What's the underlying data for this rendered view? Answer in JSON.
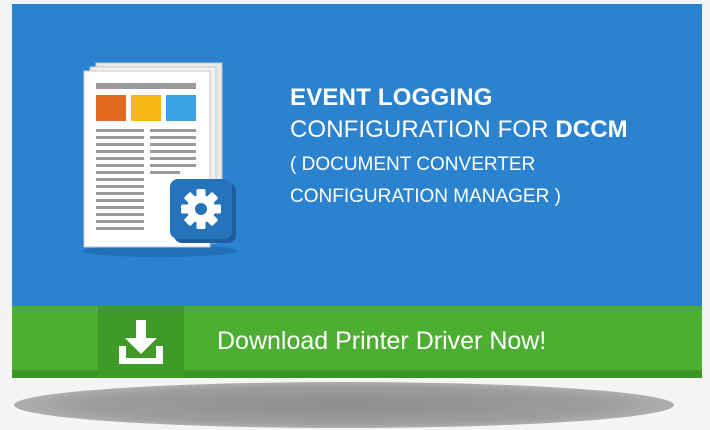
{
  "banner": {
    "title": "EVENT LOGGING",
    "subtitle_prefix": "CONFIGURATION FOR ",
    "subtitle_bold": "DCCM",
    "description_line1": "( DOCUMENT CONVERTER",
    "description_line2": "CONFIGURATION MANAGER )",
    "illustration_icon": "document-with-gear-icon"
  },
  "download": {
    "label": "Download Printer Driver Now!",
    "icon": "download-icon"
  },
  "colors": {
    "panel_blue": "#2b82cf",
    "button_green": "#4caf32",
    "icon_box_green": "#3f9a2a",
    "orange": "#e06a1f",
    "yellow": "#f5b711",
    "light_blue": "#3aa3e3"
  }
}
